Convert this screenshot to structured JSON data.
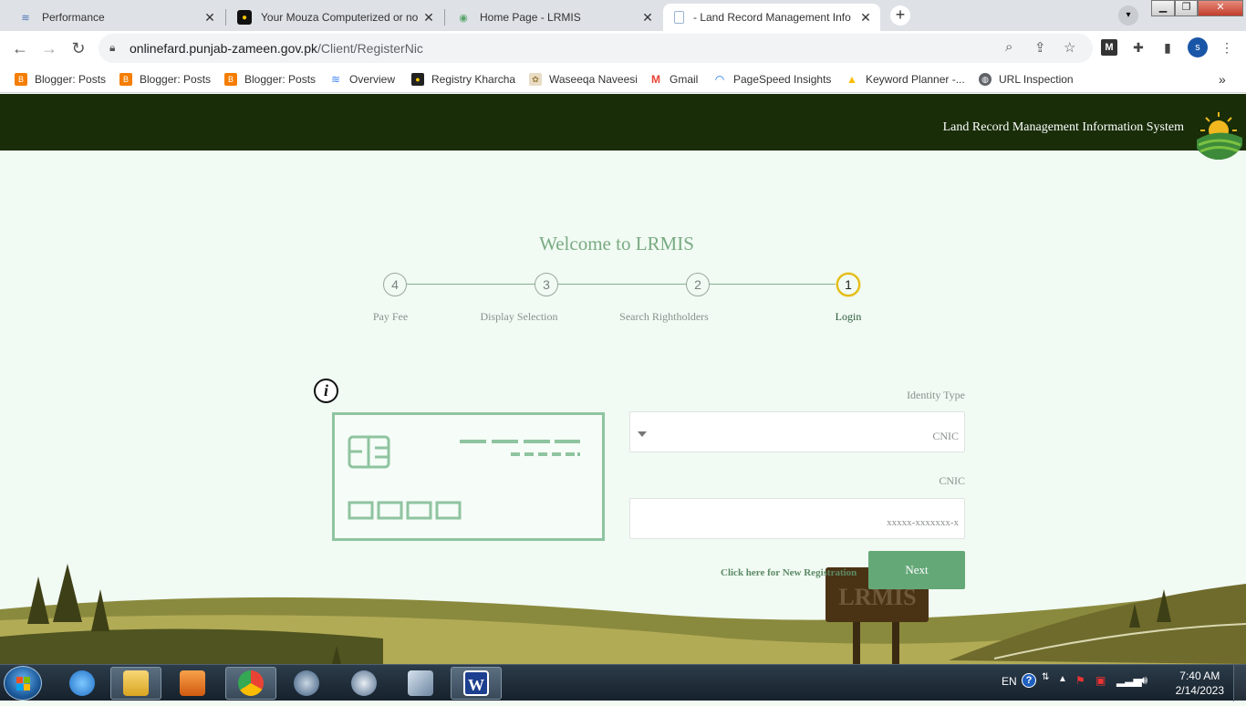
{
  "browser": {
    "tabs": [
      {
        "title": "Performance",
        "favicon": "performance-icon"
      },
      {
        "title": "Your Mouza Computerized or no",
        "favicon": "yellow-app-icon"
      },
      {
        "title": "Home Page - LRMIS",
        "favicon": "lrmis-icon"
      },
      {
        "title": "- Land Record Management Info",
        "favicon": "doc-icon"
      }
    ],
    "address": {
      "host": "onlinefard.punjab-zameen.gov.pk",
      "path": "/Client/RegisterNic"
    },
    "profile_initial": "s",
    "bookmarks": [
      {
        "label": "Blogger: Posts",
        "icon": "blogger-icon",
        "color": "#f57d00"
      },
      {
        "label": "Blogger: Posts",
        "icon": "blogger-icon",
        "color": "#f57d00"
      },
      {
        "label": "Blogger: Posts",
        "icon": "blogger-icon",
        "color": "#f57d00"
      },
      {
        "label": "Overview",
        "icon": "overview-icon",
        "color": "#4285f4"
      },
      {
        "label": "Registry Kharcha",
        "icon": "registry-icon",
        "color": "#222222"
      },
      {
        "label": "Waseeqa Naveesi",
        "icon": "waseeqa-icon",
        "color": "#c9a46a"
      },
      {
        "label": "Gmail",
        "icon": "gmail-icon",
        "color": "#ea4335"
      },
      {
        "label": "PageSpeed Insights",
        "icon": "pagespeed-icon",
        "color": "#1a73e8"
      },
      {
        "label": "Keyword Planner -...",
        "icon": "keyword-planner-icon",
        "color": "#fbbc04"
      },
      {
        "label": "URL Inspection",
        "icon": "globe-icon",
        "color": "#5f6368"
      }
    ]
  },
  "site": {
    "header_title": "Land Record Management Information System",
    "welcome": "Welcome to LRMIS",
    "steps": [
      {
        "number": "4",
        "label": "Pay Fee"
      },
      {
        "number": "3",
        "label": "Display Selection"
      },
      {
        "number": "2",
        "label": "Search Rightholders"
      },
      {
        "number": "1",
        "label": "Login"
      }
    ],
    "active_step": "1",
    "form": {
      "identity_type_label": "Identity Type",
      "identity_type_value": "CNIC",
      "cnic_label": "CNIC",
      "cnic_placeholder": "xxxxx-xxxxxxx-x",
      "new_registration_link": "Click here for New Registration",
      "next_button": "Next"
    },
    "sign_text": "LRMIS"
  },
  "taskbar": {
    "language": "EN",
    "time": "7:40 AM",
    "date": "2/14/2023"
  },
  "colors": {
    "header_bg": "#182d08",
    "accent_green": "#65a878",
    "page_bg": "#f1faf3",
    "active_step_ring": "#e2b90b"
  }
}
